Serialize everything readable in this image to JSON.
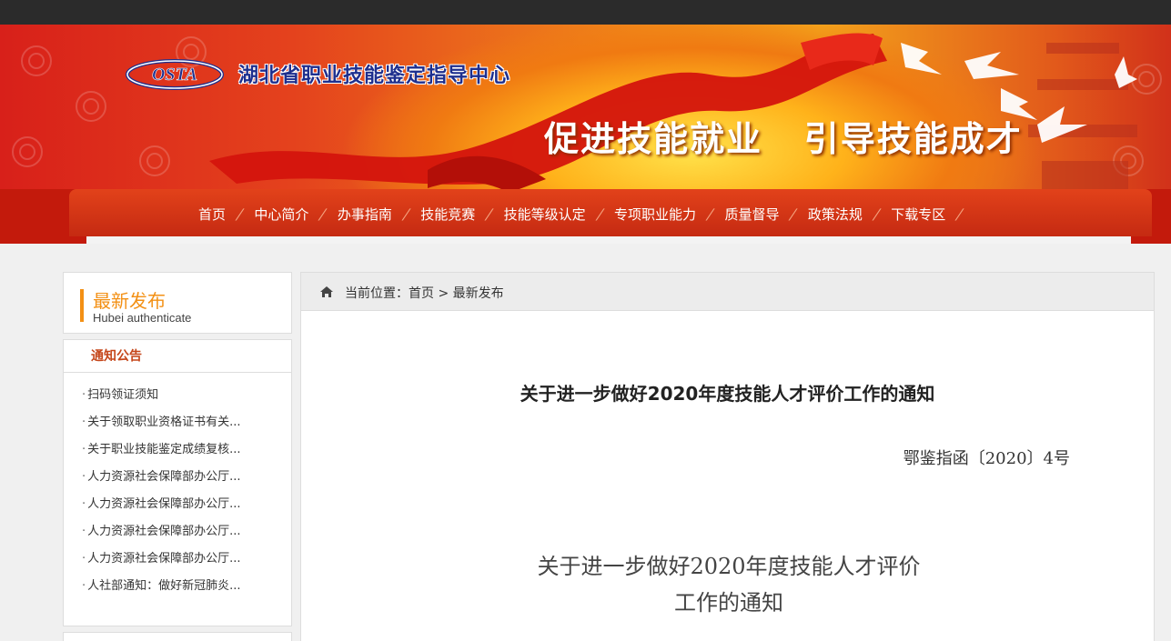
{
  "header": {
    "logo_text": "OSTA",
    "site_name": "湖北省职业技能鉴定指导中心",
    "slogan": "促进技能就业   引导技能成才"
  },
  "nav": {
    "items": [
      {
        "label": "首页"
      },
      {
        "label": "中心简介"
      },
      {
        "label": "办事指南"
      },
      {
        "label": "技能竞赛"
      },
      {
        "label": "技能等级认定"
      },
      {
        "label": "专项职业能力"
      },
      {
        "label": "质量督导"
      },
      {
        "label": "政策法规"
      },
      {
        "label": "下载专区"
      }
    ]
  },
  "sidebar": {
    "title": "最新发布",
    "subtitle": "Hubei authenticate",
    "category": "通知公告",
    "items": [
      {
        "label": "扫码领证须知"
      },
      {
        "label": "关于领取职业资格证书有关..."
      },
      {
        "label": "关于职业技能鉴定成绩复核..."
      },
      {
        "label": "人力资源社会保障部办公厅..."
      },
      {
        "label": "人力资源社会保障部办公厅..."
      },
      {
        "label": "人力资源社会保障部办公厅..."
      },
      {
        "label": "人力资源社会保障部办公厅..."
      },
      {
        "label": "人社部通知：做好新冠肺炎..."
      }
    ]
  },
  "breadcrumb": {
    "prefix": "当前位置：",
    "home": "首页",
    "separator": " > ",
    "current": "最新发布"
  },
  "article": {
    "title": "关于进一步做好2020年度技能人才评价工作的通知",
    "doc_number": "鄂鉴指函〔2020〕4号",
    "body_title_line1": "关于进一步做好2020年度技能人才评价",
    "body_title_line2": "工作的通知"
  },
  "colors": {
    "nav_red": "#c31a0c",
    "accent_orange": "#f39014",
    "category_red": "#c5461a",
    "logo_blue": "#1e2f8e"
  }
}
